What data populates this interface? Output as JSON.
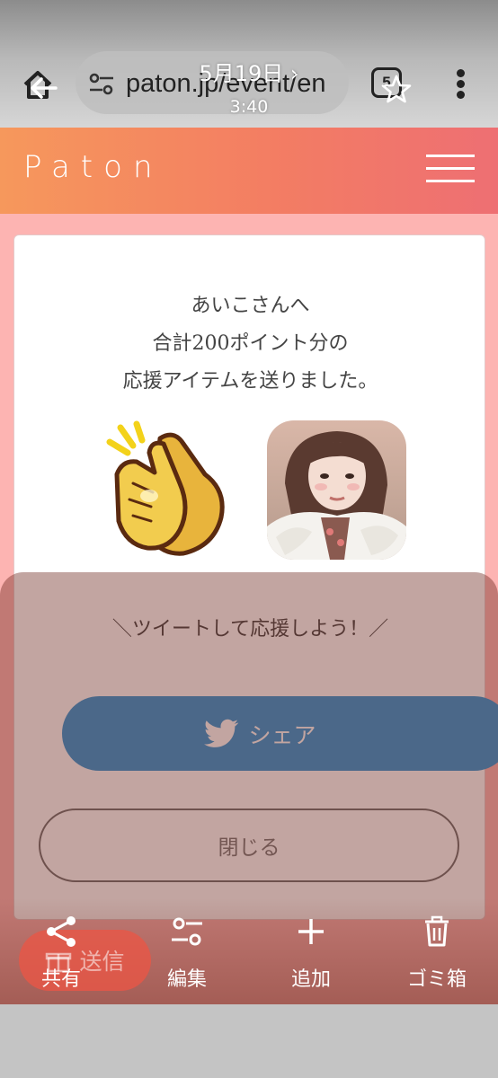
{
  "status": {
    "date": "5月19日 ›",
    "time": "3:40"
  },
  "browser": {
    "url": "paton.jp/event/en",
    "tab_count": "5"
  },
  "site": {
    "logo": "Paton",
    "brand_gradient": [
      "#f6985c",
      "#ee6f73"
    ]
  },
  "card": {
    "message_line1": "あいこさんへ",
    "message_line2": "合計200ポイント分の",
    "message_line3": "応援アイテムを送りました。",
    "tweet_cta": "＼ツイートして応援しよう！／",
    "share_label": "シェア",
    "close_label": "閉じる"
  },
  "send_button": {
    "label": "送信"
  },
  "actions": [
    {
      "label": "共有",
      "icon": "share-icon"
    },
    {
      "label": "編集",
      "icon": "tune-icon"
    },
    {
      "label": "追加",
      "icon": "plus-icon"
    },
    {
      "label": "ゴミ箱",
      "icon": "trash-icon"
    }
  ],
  "colors": {
    "share_button": "#3397d6",
    "page_background": "#fdb4b2"
  }
}
